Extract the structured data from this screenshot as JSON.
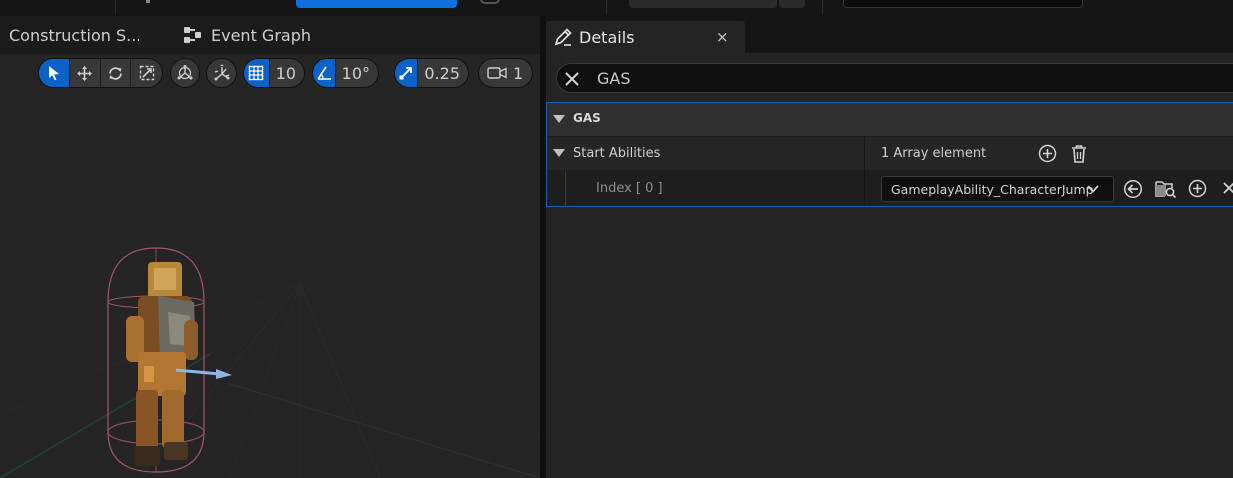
{
  "left_panel": {
    "tabs": {
      "construction": "Construction S...",
      "event_graph": "Event Graph"
    },
    "toolbar": {
      "grid_snap_value": "10",
      "rotation_snap_value": "10°",
      "scale_snap_value": "0.25",
      "camera_speed_value": "1"
    }
  },
  "details": {
    "tab_label": "Details",
    "close_glyph": "×",
    "search_value": "GAS",
    "category_label": "GAS",
    "property_label": "Start Abilities",
    "array_count": "1 Array element",
    "index_label": "Index [ 0 ]",
    "index_value": "GameplayAbility_CharacterJump"
  },
  "colors": {
    "accent": "#0c62c7",
    "selection_border": "#1c5fb3",
    "panel": "#242424",
    "viewport": "#252525"
  },
  "icons": [
    "select-icon",
    "move-icon",
    "rotate-icon",
    "scale-icon",
    "world-local-icon",
    "surface-snap-icon",
    "grid-icon",
    "angle-icon",
    "scale-snap-icon",
    "camera-icon",
    "pencil-icon",
    "close-icon",
    "add-circle-icon",
    "trash-icon",
    "use-selected-icon",
    "browse-icon",
    "clear-icon"
  ]
}
